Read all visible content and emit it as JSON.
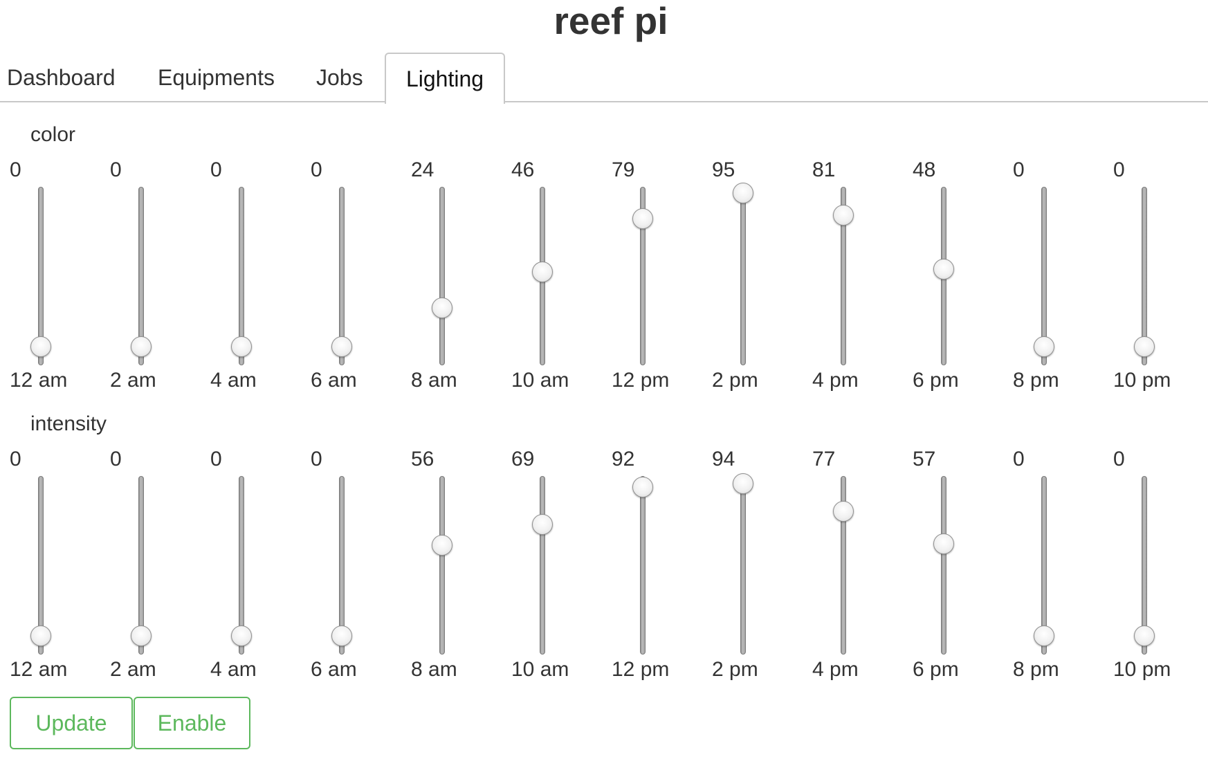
{
  "app": {
    "title": "reef pi"
  },
  "tabs": [
    {
      "label": "Dashboard",
      "active": false
    },
    {
      "label": "Equipments",
      "active": false
    },
    {
      "label": "Jobs",
      "active": false
    },
    {
      "label": "Lighting",
      "active": true
    }
  ],
  "lighting": {
    "slider_range": [
      0,
      100
    ],
    "groups": [
      {
        "label": "color",
        "slots": [
          {
            "value": "0",
            "time": "12 am"
          },
          {
            "value": "0",
            "time": "2 am"
          },
          {
            "value": "0",
            "time": "4 am"
          },
          {
            "value": "0",
            "time": "6 am"
          },
          {
            "value": "24",
            "time": "8 am"
          },
          {
            "value": "46",
            "time": "10 am"
          },
          {
            "value": "79",
            "time": "12 pm"
          },
          {
            "value": "95",
            "time": "2 pm"
          },
          {
            "value": "81",
            "time": "4 pm"
          },
          {
            "value": "48",
            "time": "6 pm"
          },
          {
            "value": "0",
            "time": "8 pm"
          },
          {
            "value": "0",
            "time": "10 pm"
          }
        ]
      },
      {
        "label": "intensity",
        "slots": [
          {
            "value": "0",
            "time": "12 am"
          },
          {
            "value": "0",
            "time": "2 am"
          },
          {
            "value": "0",
            "time": "4 am"
          },
          {
            "value": "0",
            "time": "6 am"
          },
          {
            "value": "56",
            "time": "8 am"
          },
          {
            "value": "69",
            "time": "10 am"
          },
          {
            "value": "92",
            "time": "12 pm"
          },
          {
            "value": "94",
            "time": "2 pm"
          },
          {
            "value": "77",
            "time": "4 pm"
          },
          {
            "value": "57",
            "time": "6 pm"
          },
          {
            "value": "0",
            "time": "8 pm"
          },
          {
            "value": "0",
            "time": "10 pm"
          }
        ]
      }
    ]
  },
  "buttons": {
    "update": "Update",
    "enable": "Enable"
  },
  "colors": {
    "accent": "#5cb85c",
    "text": "#333333",
    "border": "#c8c8c8"
  }
}
